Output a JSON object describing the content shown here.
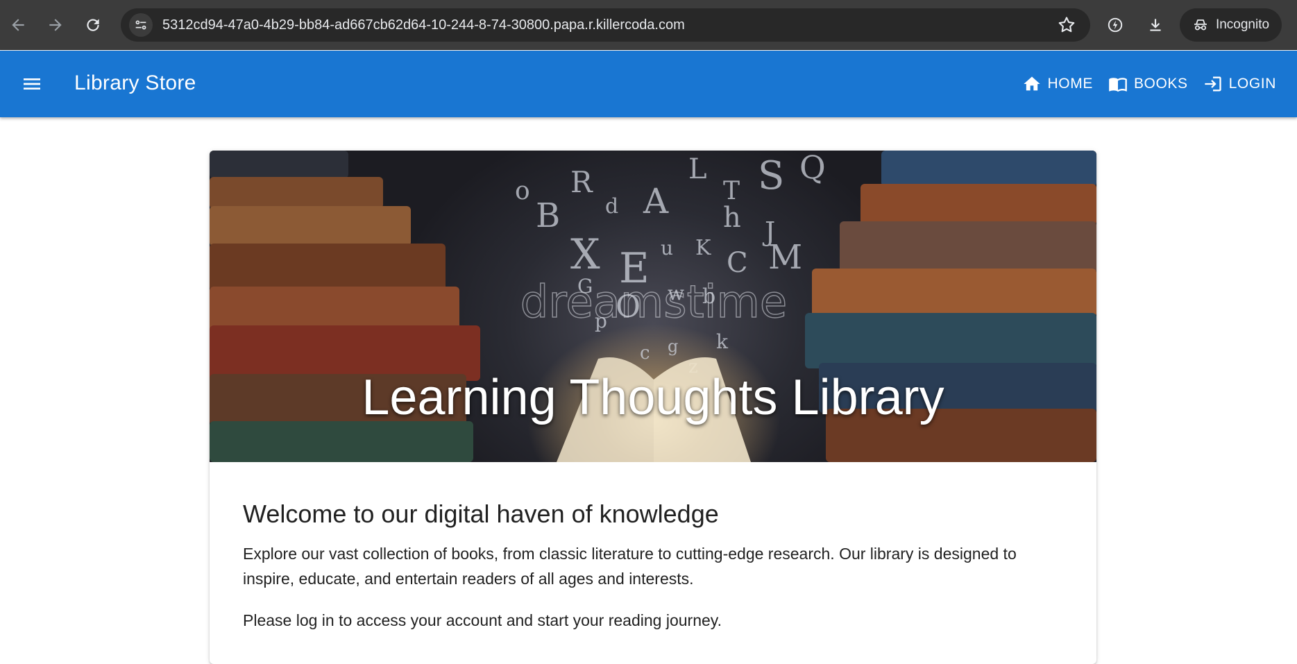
{
  "browser": {
    "url": "5312cd94-47a0-4b29-bb84-ad667cb62d64-10-244-8-74-30800.papa.r.killercoda.com",
    "incognito_label": "Incognito"
  },
  "appbar": {
    "title": "Library Store",
    "nav": [
      {
        "label": "HOME",
        "icon": "home-icon"
      },
      {
        "label": "BOOKS",
        "icon": "book-open-icon"
      },
      {
        "label": "LOGIN",
        "icon": "login-icon"
      }
    ],
    "color": "#1976d2"
  },
  "hero": {
    "title": "Learning Thoughts Library",
    "watermark": "dreamstime"
  },
  "content": {
    "heading": "Welcome to our digital haven of knowledge",
    "paragraph1": "Explore our vast collection of books, from classic literature to cutting-edge research. Our library is designed to inspire, educate, and entertain readers of all ages and interests.",
    "paragraph2": "Please log in to access your account and start your reading journey."
  }
}
